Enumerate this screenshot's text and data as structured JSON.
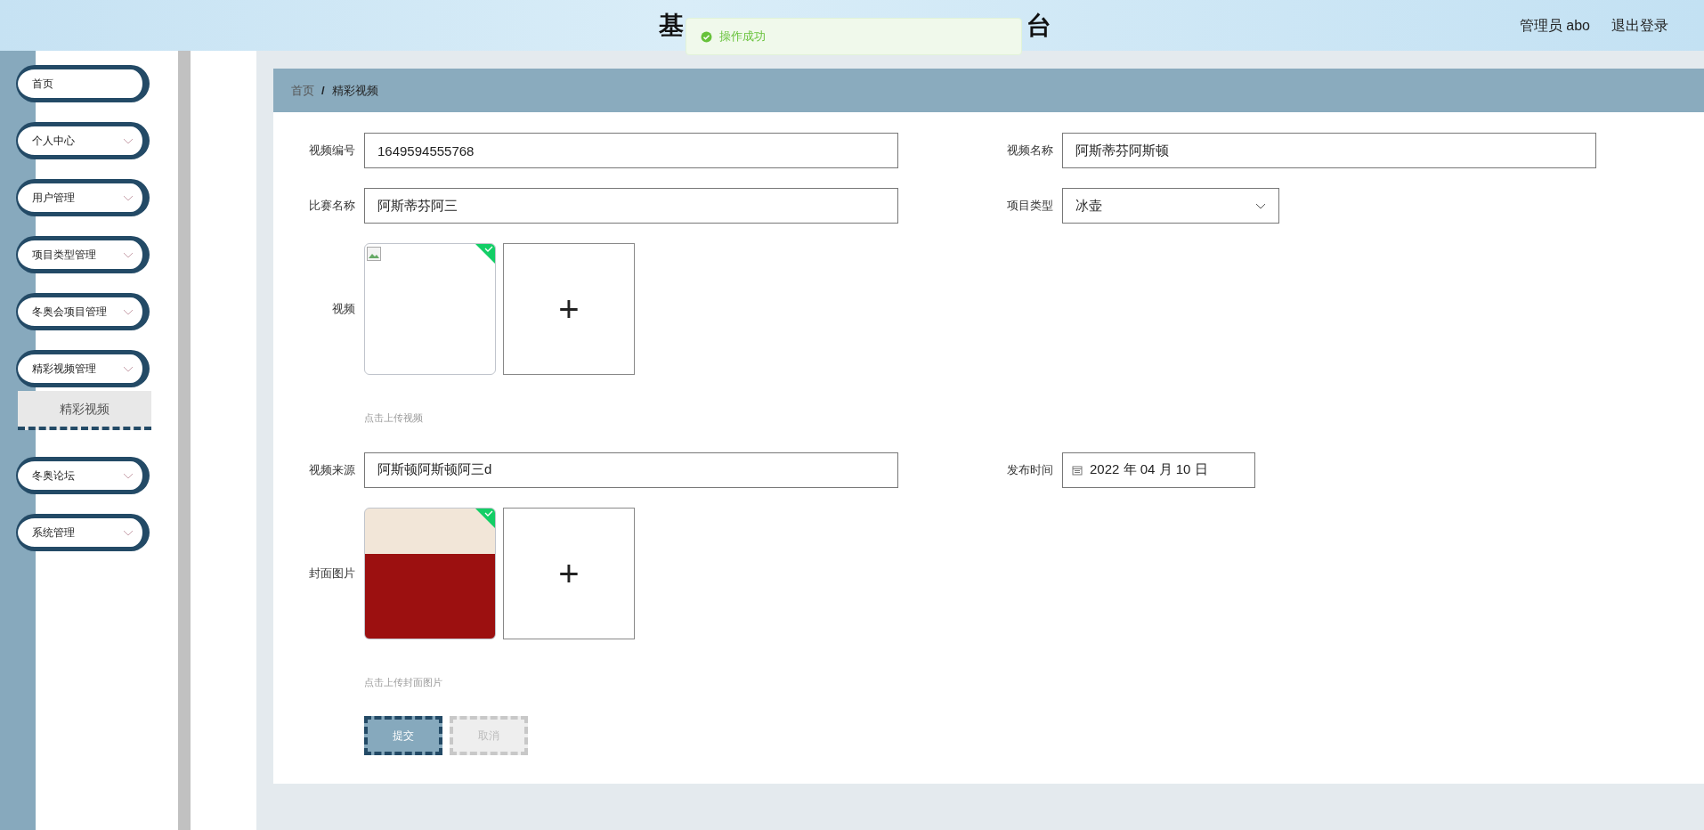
{
  "header": {
    "title_parts": [
      "基",
      "台"
    ],
    "user": "管理员 abo",
    "logout": "退出登录"
  },
  "toast": {
    "kind": "success",
    "text": "操作成功"
  },
  "sidebar": {
    "items": [
      {
        "label": "首页",
        "has_children": false
      },
      {
        "label": "个人中心",
        "has_children": true
      },
      {
        "label": "用户管理",
        "has_children": true
      },
      {
        "label": "项目类型管理",
        "has_children": true
      },
      {
        "label": "冬奥会项目管理",
        "has_children": true
      },
      {
        "label": "精彩视频管理",
        "has_children": true,
        "children": [
          {
            "label": "精彩视频",
            "selected": true
          }
        ]
      },
      {
        "label": "冬奥论坛",
        "has_children": true
      },
      {
        "label": "系统管理",
        "has_children": true
      }
    ]
  },
  "breadcrumb": [
    {
      "label": "首页",
      "current": false
    },
    {
      "label": "精彩视频",
      "current": true
    }
  ],
  "breadcrumb_separator": "/",
  "form": {
    "rows": [
      {
        "kind": "pair",
        "fields": [
          {
            "kind": "text",
            "label": "视频编号",
            "value": "1649594555768"
          },
          {
            "kind": "text",
            "label": "视频名称",
            "value": "阿斯蒂芬阿斯顿"
          }
        ]
      },
      {
        "kind": "pair",
        "fields": [
          {
            "kind": "text",
            "label": "比赛名称",
            "value": "阿斯蒂芬阿三"
          },
          {
            "kind": "select",
            "label": "项目类型",
            "value": "冰壶"
          }
        ]
      },
      {
        "kind": "video-upload",
        "label": "视频",
        "uploaded": true,
        "hint": "点击上传视频",
        "add_symbol": "+"
      },
      {
        "kind": "pair",
        "fields": [
          {
            "kind": "text",
            "label": "视频来源",
            "value": "阿斯顿阿斯顿阿三d"
          },
          {
            "kind": "date",
            "label": "发布时间",
            "value": "2022 年 04 月 10 日"
          }
        ]
      },
      {
        "kind": "image-upload",
        "label": "封面图片",
        "uploaded": true,
        "hint": "点击上传封面图片",
        "add_symbol": "+"
      }
    ],
    "buttons": [
      {
        "label": "提交",
        "disabled": false
      },
      {
        "label": "取消",
        "disabled": true
      }
    ]
  }
}
